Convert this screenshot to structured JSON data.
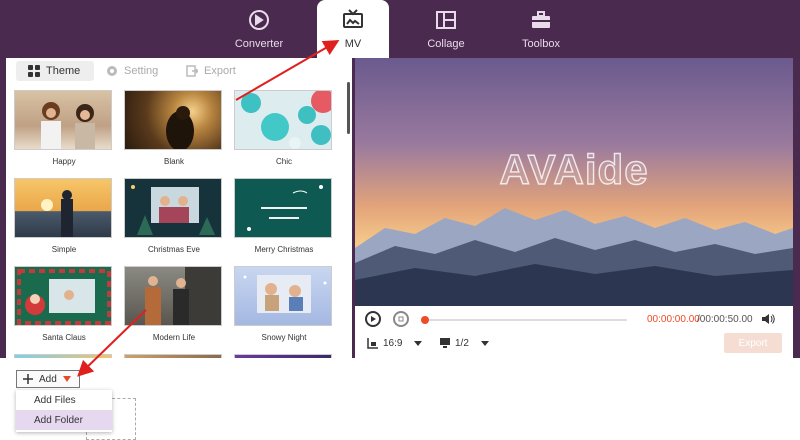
{
  "nav": {
    "tabs": [
      {
        "label": "Converter",
        "icon": "converter-icon"
      },
      {
        "label": "MV",
        "icon": "tv-icon",
        "active": true
      },
      {
        "label": "Collage",
        "icon": "collage-icon"
      },
      {
        "label": "Toolbox",
        "icon": "toolbox-icon"
      }
    ]
  },
  "subtabs": [
    {
      "label": "Theme",
      "icon": "grid-icon",
      "active": true
    },
    {
      "label": "Setting",
      "icon": "gear-icon"
    },
    {
      "label": "Export",
      "icon": "export-icon"
    }
  ],
  "themes": [
    {
      "label": "Happy"
    },
    {
      "label": "Blank"
    },
    {
      "label": "Chic"
    },
    {
      "label": "Simple"
    },
    {
      "label": "Christmas Eve"
    },
    {
      "label": "Merry Christmas"
    },
    {
      "label": "Santa Claus"
    },
    {
      "label": "Modern Life"
    },
    {
      "label": "Snowy Night"
    }
  ],
  "preview": {
    "watermark": "AVAide"
  },
  "player": {
    "time_current": "00:00:00.00",
    "time_total": "/00:00:50.00",
    "aspect_ratio": "16:9",
    "screen": "1/2",
    "export_label": "Export",
    "progress": 0.0
  },
  "add": {
    "label": "Add",
    "menu": [
      {
        "label": "Add Files"
      },
      {
        "label": "Add Folder",
        "hover": true
      }
    ]
  },
  "colors": {
    "bg": "#4a2a4e",
    "accent": "#f04a26"
  }
}
